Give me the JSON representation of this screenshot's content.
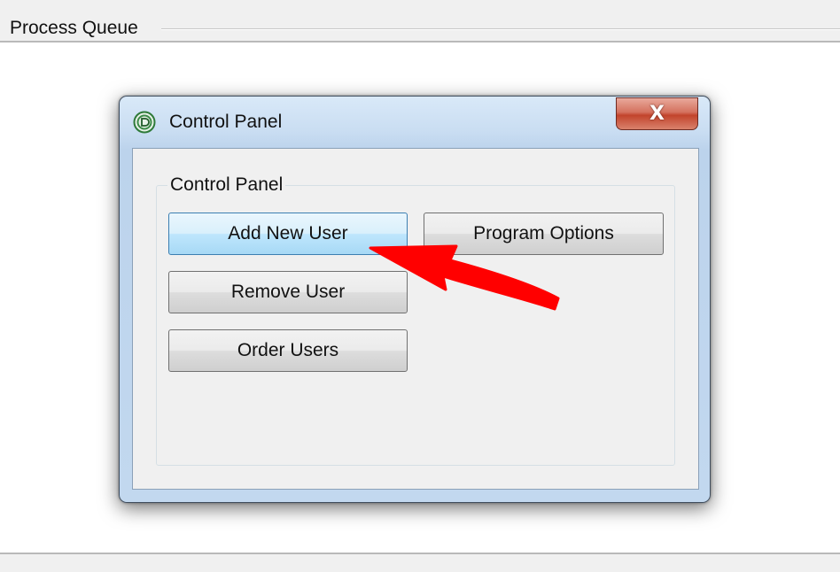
{
  "page": {
    "section_title": "Process Queue"
  },
  "dialog": {
    "title": "Control Panel",
    "close_glyph": "X",
    "groupbox_label": "Control Panel",
    "buttons": {
      "add_user": "Add New User",
      "program_options": "Program Options",
      "remove_user": "Remove User",
      "order_users": "Order Users"
    }
  },
  "annotation": {
    "arrow_color": "#ff0000",
    "arrow_target": "Add New User"
  },
  "colors": {
    "close_button": "#c8452e",
    "title_bar": "#c6daf0",
    "focused_button_border": "#3c7fb1"
  }
}
